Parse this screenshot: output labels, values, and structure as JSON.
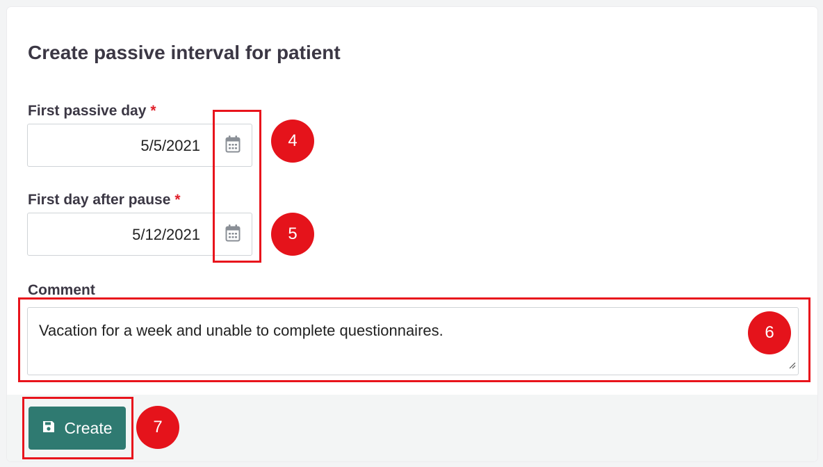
{
  "form": {
    "title": "Create passive interval for patient",
    "required_marker": "*",
    "first_passive_day": {
      "label": "First passive day",
      "value": "5/5/2021",
      "icon": "calendar-icon"
    },
    "first_day_after_pause": {
      "label": "First day after pause",
      "value": "5/12/2021",
      "icon": "calendar-icon"
    },
    "comment": {
      "label": "Comment",
      "value": "Vacation for a week and unable to complete questionnaires."
    },
    "create_button": {
      "label": "Create",
      "icon": "save-icon"
    }
  },
  "annotations": {
    "badges": [
      "4",
      "5",
      "6",
      "7"
    ],
    "highlight_color": "#e8141c"
  },
  "colors": {
    "primary_button": "#2f7a71",
    "badge": "#e5131b",
    "required": "#e0202a"
  }
}
